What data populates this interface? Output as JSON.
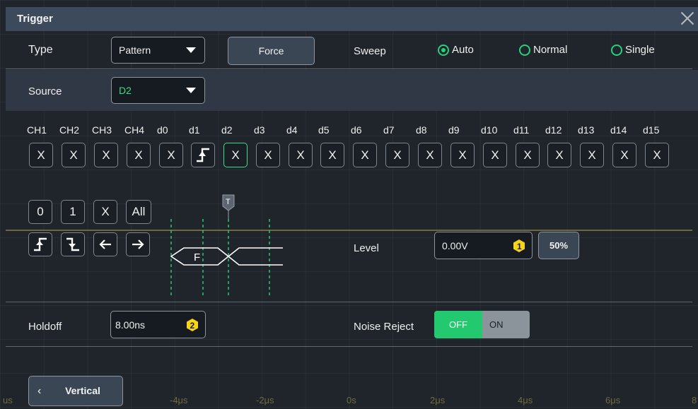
{
  "dialog": {
    "title": "Trigger"
  },
  "type": {
    "label": "Type",
    "value": "Pattern"
  },
  "force_label": "Force",
  "sweep": {
    "label": "Sweep",
    "options": [
      {
        "label": "Auto",
        "selected": true
      },
      {
        "label": "Normal",
        "selected": false
      },
      {
        "label": "Single",
        "selected": false
      }
    ]
  },
  "source": {
    "label": "Source",
    "value": "D2",
    "value_color": "#3ddc84"
  },
  "channels": [
    {
      "name": "CH1",
      "state": "X"
    },
    {
      "name": "CH2",
      "state": "X"
    },
    {
      "name": "CH3",
      "state": "X"
    },
    {
      "name": "CH4",
      "state": "X"
    },
    {
      "name": "d0",
      "state": "X"
    },
    {
      "name": "d1",
      "state": "rising-edge"
    },
    {
      "name": "d2",
      "state": "X"
    },
    {
      "name": "d3",
      "state": "X"
    },
    {
      "name": "d4",
      "state": "X"
    },
    {
      "name": "d5",
      "state": "X"
    },
    {
      "name": "d6",
      "state": "X"
    },
    {
      "name": "d7",
      "state": "X"
    },
    {
      "name": "d8",
      "state": "X"
    },
    {
      "name": "d9",
      "state": "X"
    },
    {
      "name": "d10",
      "state": "X"
    },
    {
      "name": "d11",
      "state": "X"
    },
    {
      "name": "d12",
      "state": "X"
    },
    {
      "name": "d13",
      "state": "X"
    },
    {
      "name": "d14",
      "state": "X"
    },
    {
      "name": "d15",
      "state": "X"
    }
  ],
  "pattern_buttons": {
    "zero": "0",
    "one": "1",
    "dontcare": "X",
    "all": "All"
  },
  "edge_buttons": [
    "rising-edge-icon",
    "falling-edge-icon",
    "arrow-left-icon",
    "arrow-right-icon"
  ],
  "diagram": {
    "bus_label": "F",
    "trigger_marker": "T"
  },
  "level": {
    "label": "Level",
    "value": "0.00V",
    "badge": "1",
    "fifty_label": "50%"
  },
  "holdoff": {
    "label": "Holdoff",
    "value": "8.00ns",
    "badge": "2"
  },
  "noise_reject": {
    "label": "Noise Reject",
    "off": "OFF",
    "on": "ON",
    "active": "OFF"
  },
  "back_button": {
    "label": "Vertical"
  },
  "x_axis": {
    "ticks": [
      "us",
      "-4μs",
      "-2μs",
      "0s",
      "2μs",
      "4μs",
      "6μs",
      "8"
    ]
  },
  "colors": {
    "accent": "#29d07a",
    "badge": "#f5d516",
    "trace": "#8a8650"
  }
}
